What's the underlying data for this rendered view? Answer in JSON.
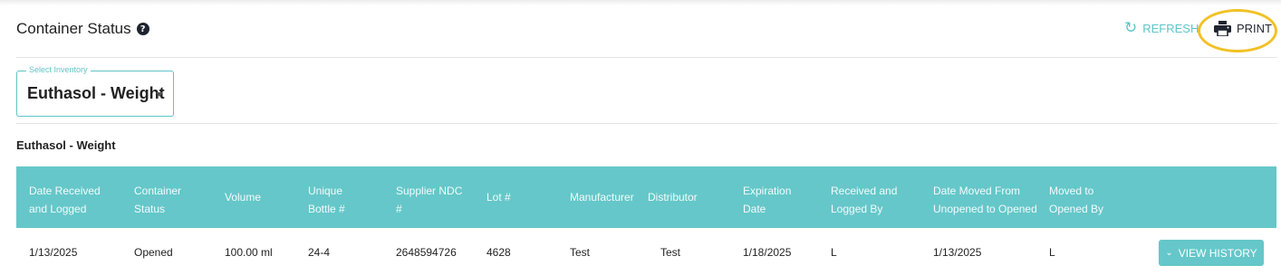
{
  "header": {
    "title": "Container Status",
    "help_icon": "?",
    "refresh_label": "REFRESH",
    "print_label": "PRINT"
  },
  "selector": {
    "label": "Select Inventory",
    "value": "Euthasol - Weight"
  },
  "section": {
    "title": "Euthasol - Weight"
  },
  "table": {
    "headers": {
      "date_received": [
        "Date Received",
        "and Logged"
      ],
      "container_status": [
        "Container",
        "Status"
      ],
      "volume": [
        "Volume"
      ],
      "unique_bottle": [
        "Unique",
        "Bottle #"
      ],
      "supplier_ndc": [
        "Supplier NDC",
        "#"
      ],
      "lot": [
        "Lot #"
      ],
      "manufacturer": [
        "Manufacturer"
      ],
      "distributor": [
        "Distributor"
      ],
      "expiration": [
        "Expiration",
        "Date"
      ],
      "received_by": [
        "Received and",
        "Logged By"
      ],
      "date_moved": [
        "Date Moved From",
        "Unopened to Opened"
      ],
      "moved_by": [
        "Moved to",
        "Opened By"
      ]
    },
    "rows": [
      {
        "date_received": "1/13/2025",
        "container_status": "Opened",
        "volume": "100.00 ml",
        "unique_bottle": "24-4",
        "supplier_ndc": "2648594726",
        "lot": "4628",
        "manufacturer": "Test",
        "distributor": "Test",
        "expiration": "1/18/2025",
        "received_by": "L",
        "date_moved": "1/13/2025",
        "moved_by": "L",
        "action_label": "VIEW HISTORY"
      }
    ]
  },
  "colors": {
    "accent": "#65c7c9",
    "highlight": "#f2c125",
    "dark": "#1f2430"
  }
}
